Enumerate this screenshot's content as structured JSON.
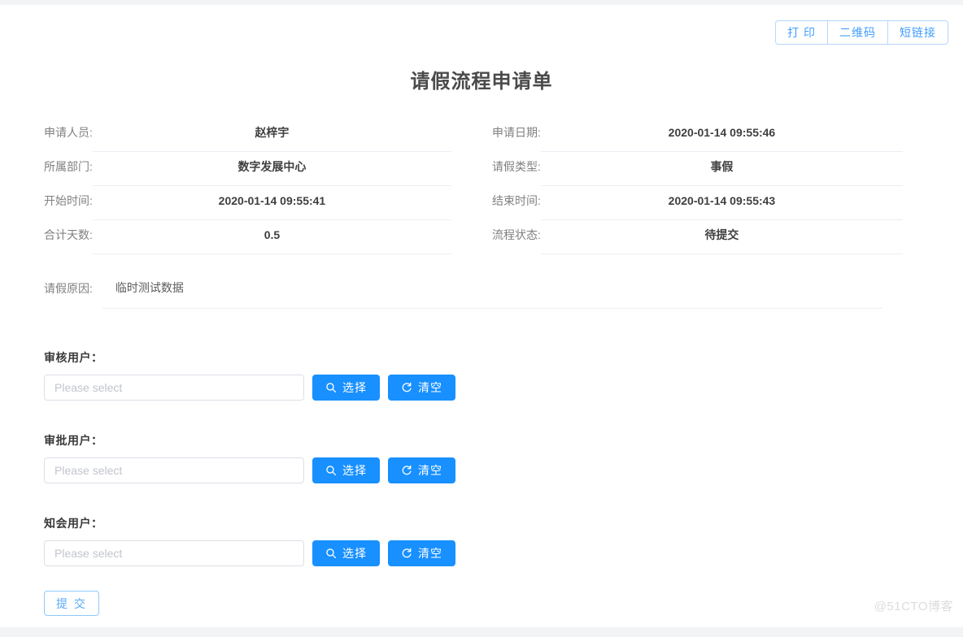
{
  "toolbar": {
    "buttons": [
      {
        "label": "打 印",
        "name": "print-button"
      },
      {
        "label": "二维码",
        "name": "qrcode-button"
      },
      {
        "label": "短链接",
        "name": "shortlink-button"
      }
    ]
  },
  "document": {
    "title": "请假流程申请单"
  },
  "form": {
    "rows": [
      {
        "left": {
          "label": "申请人员:",
          "value": "赵梓宇"
        },
        "right": {
          "label": "申请日期:",
          "value": "2020-01-14 09:55:46"
        }
      },
      {
        "left": {
          "label": "所属部门:",
          "value": "数字发展中心"
        },
        "right": {
          "label": "请假类型:",
          "value": "事假"
        }
      },
      {
        "left": {
          "label": "开始时间:",
          "value": "2020-01-14 09:55:41"
        },
        "right": {
          "label": "结束时间:",
          "value": "2020-01-14 09:55:43"
        }
      },
      {
        "left": {
          "label": "合计天数:",
          "value": "0.5"
        },
        "right": {
          "label": "流程状态:",
          "value": "待提交"
        }
      }
    ],
    "reason": {
      "label": "请假原因:",
      "value": "临时测试数据"
    }
  },
  "pickers": [
    {
      "key": "review",
      "label": "审核用户：",
      "input_value": "",
      "placeholder": "Please select",
      "select_button": "选择",
      "clear_button": "清空",
      "select_icon": "search-icon",
      "clear_icon": "refresh-icon"
    },
    {
      "key": "approve",
      "label": "审批用户：",
      "input_value": "",
      "placeholder": "Please select",
      "select_button": "选择",
      "clear_button": "清空",
      "select_icon": "search-icon",
      "clear_icon": "refresh-icon"
    },
    {
      "key": "notify",
      "label": "知会用户：",
      "input_value": "",
      "placeholder": "Please select",
      "select_button": "选择",
      "clear_button": "清空",
      "select_icon": "search-icon",
      "clear_icon": "refresh-icon"
    }
  ],
  "actions": {
    "submit_label": "提 交"
  },
  "watermark": {
    "text": "@51CTO博客"
  },
  "colors": {
    "primary_blue": "#1890ff",
    "link_blue": "#409eff",
    "border_light": "#ebeef5",
    "input_border": "#dcdfe6",
    "placeholder": "#c0c4cc",
    "label_gray": "#808080",
    "watermark_gray": "#dcdcdc"
  }
}
